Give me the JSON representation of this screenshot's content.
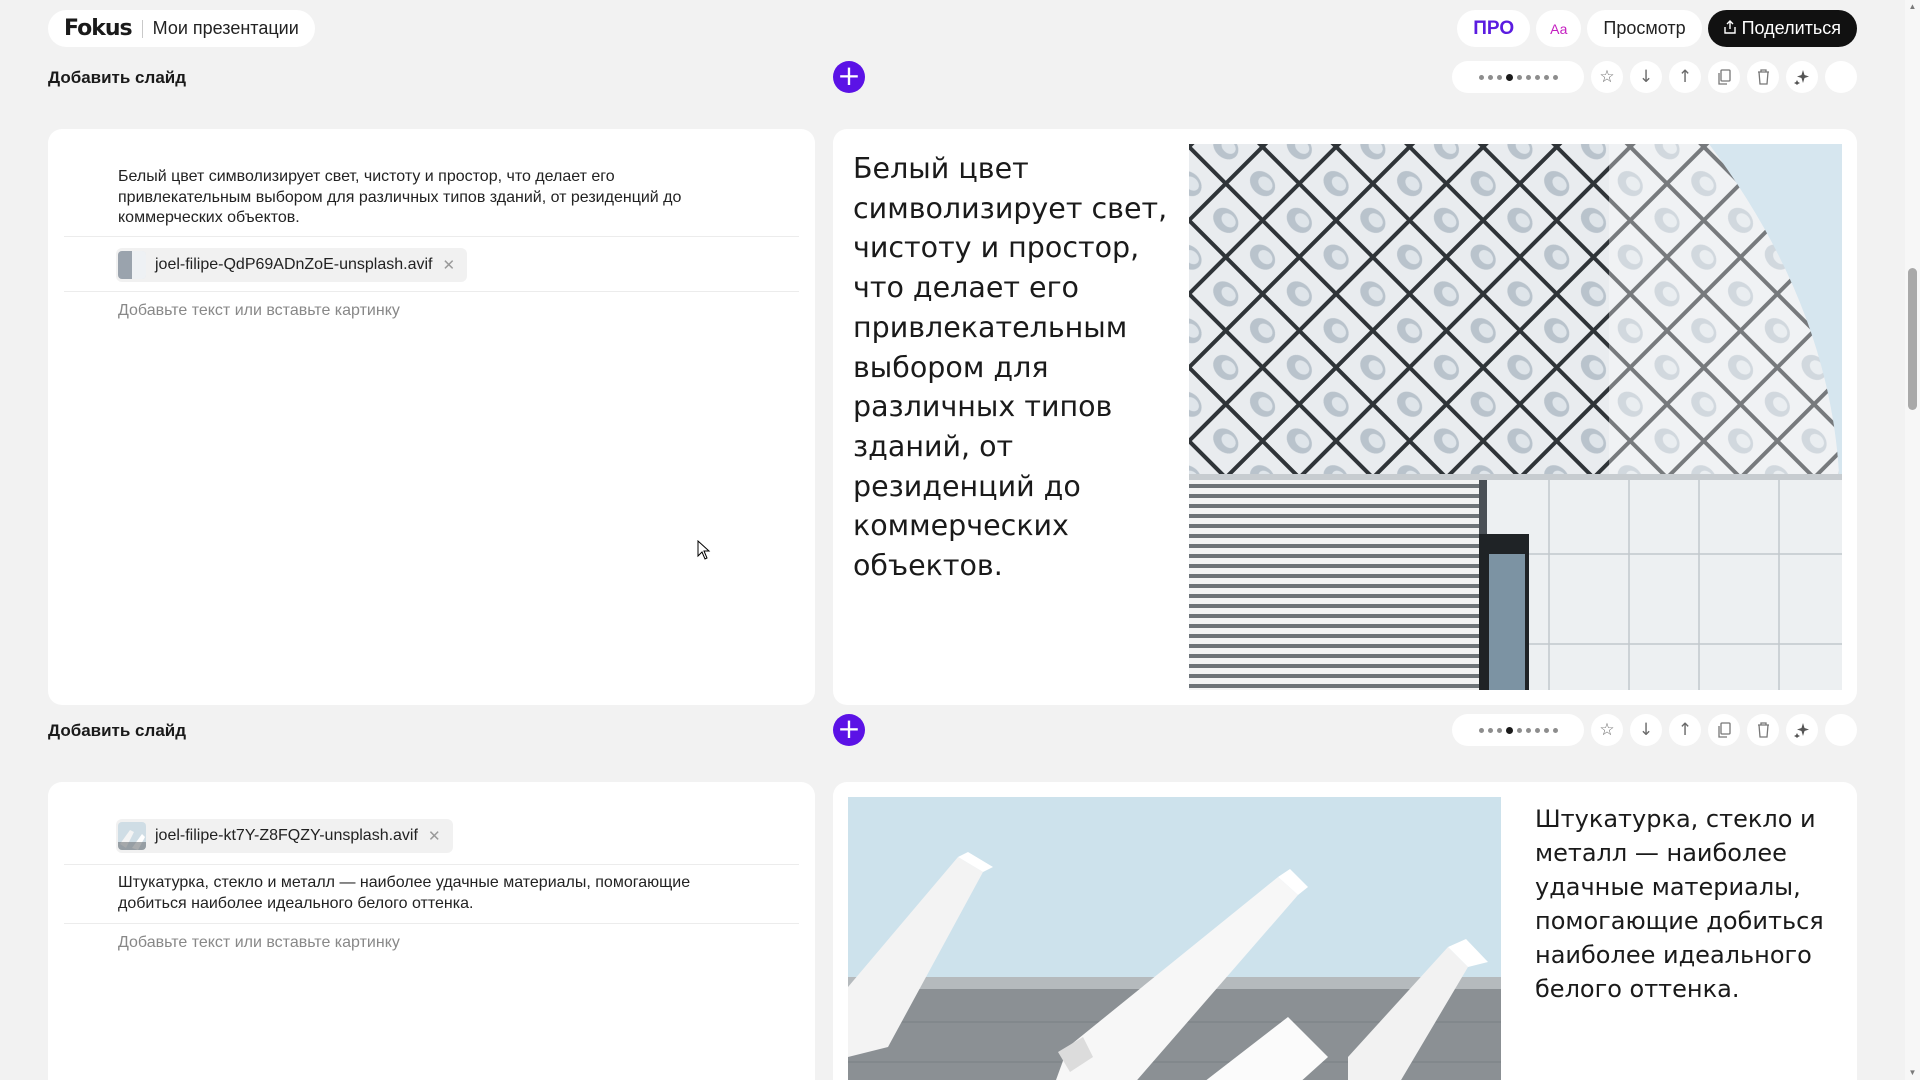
{
  "header": {
    "logo": "Fokus",
    "breadcrumb": "Мои презентации",
    "pro_label": "ПРО",
    "font_label": "Аа",
    "preview_label": "Просмотр",
    "share_label": "Поделиться",
    "share_icon": "share-icon"
  },
  "slides": [
    {
      "add_slide_label": "Добавить слайд",
      "add_icon": "+",
      "dots_total": 9,
      "dots_active_index": 3,
      "tools": [
        "star-icon",
        "arrow-down-icon",
        "arrow-up-icon",
        "copy-icon",
        "trash-icon",
        "sparkle-icon"
      ],
      "editor": {
        "text": "Белый цвет символизирует свет, чистоту и простор, что делает его привлекательным выбором для различных типов зданий, от резиденций до коммерческих объектов.",
        "attachment": "joel-filipe-QdP69ADnZoE-unsplash.avif",
        "placeholder": "Добавьте текст или вставьте картинку"
      },
      "preview": {
        "text": "Белый цвет символизирует свет, чистоту и простор, что делает его привлекательным выбором для различных типов зданий, от резиденций до коммерческих объектов."
      }
    },
    {
      "add_slide_label": "Добавить слайд",
      "add_icon": "+",
      "dots_total": 9,
      "dots_active_index": 3,
      "tools": [
        "star-icon",
        "arrow-down-icon",
        "arrow-up-icon",
        "copy-icon",
        "trash-icon",
        "sparkle-icon"
      ],
      "editor": {
        "attachment": "joel-filipe-kt7Y-Z8FQZY-unsplash.avif",
        "text": "Штукатурка, стекло и металл — наиболее удачные материалы, помогающие добиться наиболее идеального белого оттенка.",
        "placeholder": "Добавьте текст или вставьте картинку"
      },
      "preview": {
        "text": "Штукатурка, стекло и металл — наиболее удачные материалы, помогающие добиться наиболее идеального белого оттенка."
      }
    }
  ],
  "colors": {
    "accent": "#5b12e6",
    "pro": "#5b1ce0",
    "font_badge": "#c41ec0",
    "share_bg": "#111111",
    "page_bg": "#f2f2f2"
  }
}
